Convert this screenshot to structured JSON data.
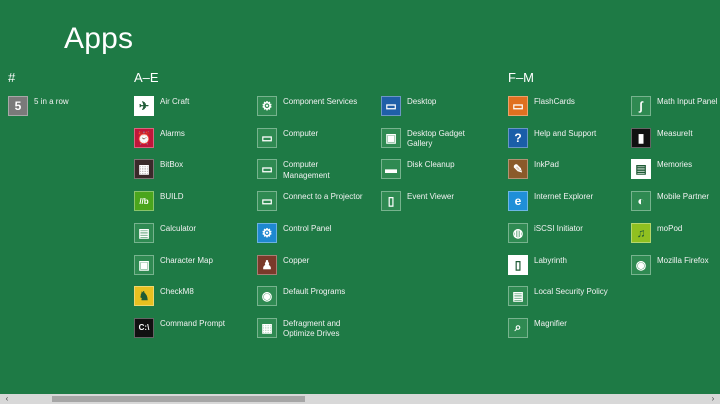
{
  "title": "Apps",
  "groups": {
    "hash": "#",
    "a_e": "A–E",
    "f_m": "F–M"
  },
  "apps": [
    {
      "label": "5 in a row",
      "icon": "five-icon",
      "glyph": "5",
      "color": "#7a7a7a"
    },
    {
      "label": "Air Craft",
      "icon": "paper-plane-icon",
      "glyph": "✈",
      "color": "#ffffff"
    },
    {
      "label": "Alarms",
      "icon": "alarm-clock-icon",
      "glyph": "⏰",
      "color": "#c0163a"
    },
    {
      "label": "BitBox",
      "icon": "bitbox-icon",
      "glyph": "▦",
      "color": "#3a2a2a"
    },
    {
      "label": "BUILD",
      "icon": "build-icon",
      "glyph": "//b",
      "color": "#4aa51d"
    },
    {
      "label": "Calculator",
      "icon": "calculator-icon",
      "glyph": "▤",
      "color": "#2f8a52"
    },
    {
      "label": "Character Map",
      "icon": "character-map-icon",
      "glyph": "▣",
      "color": "#2f8a52"
    },
    {
      "label": "CheckM8",
      "icon": "checkm8-icon",
      "glyph": "♞",
      "color": "#e8c020"
    },
    {
      "label": "Command Prompt",
      "icon": "command-prompt-icon",
      "glyph": "C:\\",
      "color": "#111111"
    },
    {
      "label": "Component Services",
      "icon": "component-services-icon",
      "glyph": "⚙",
      "color": "#2f8a52"
    },
    {
      "label": "Computer",
      "icon": "computer-icon",
      "glyph": "▭",
      "color": "#2f8a52"
    },
    {
      "label": "Computer Management",
      "icon": "computer-management-icon",
      "glyph": "▭",
      "color": "#2f8a52"
    },
    {
      "label": "Connect to a Projector",
      "icon": "projector-icon",
      "glyph": "▭",
      "color": "#2f8a52"
    },
    {
      "label": "Control Panel",
      "icon": "control-panel-icon",
      "glyph": "⚙",
      "color": "#1e88d0"
    },
    {
      "label": "Copper",
      "icon": "copper-icon",
      "glyph": "♟",
      "color": "#7a3a2a"
    },
    {
      "label": "Default Programs",
      "icon": "default-programs-icon",
      "glyph": "◉",
      "color": "#2f8a52"
    },
    {
      "label": "Defragment and Optimize Drives",
      "icon": "defragment-icon",
      "glyph": "▦",
      "color": "#2f8a52"
    },
    {
      "label": "Desktop",
      "icon": "desktop-icon",
      "glyph": "▭",
      "color": "#1f5fa8"
    },
    {
      "label": "Desktop Gadget Gallery",
      "icon": "gadget-gallery-icon",
      "glyph": "▣",
      "color": "#2f8a52"
    },
    {
      "label": "Disk Cleanup",
      "icon": "disk-cleanup-icon",
      "glyph": "▬",
      "color": "#2f8a52"
    },
    {
      "label": "Event Viewer",
      "icon": "event-viewer-icon",
      "glyph": "▯",
      "color": "#2f8a52"
    },
    {
      "label": "FlashCards",
      "icon": "flashcards-icon",
      "glyph": "▭",
      "color": "#e07020"
    },
    {
      "label": "Help and Support",
      "icon": "help-icon",
      "glyph": "?",
      "color": "#1a5ea8"
    },
    {
      "label": "InkPad",
      "icon": "inkpad-icon",
      "glyph": "✎",
      "color": "#8a5a2a"
    },
    {
      "label": "Internet Explorer",
      "icon": "internet-explorer-icon",
      "glyph": "e",
      "color": "#1f8fd8"
    },
    {
      "label": "iSCSI Initiator",
      "icon": "iscsi-icon",
      "glyph": "◍",
      "color": "#2f8a52"
    },
    {
      "label": "Labyrinth",
      "icon": "labyrinth-icon",
      "glyph": "▯",
      "color": "#ffffff"
    },
    {
      "label": "Local Security Policy",
      "icon": "security-policy-icon",
      "glyph": "▤",
      "color": "#2f8a52"
    },
    {
      "label": "Magnifier",
      "icon": "magnifier-icon",
      "glyph": "⌕",
      "color": "#2f8a52"
    },
    {
      "label": "Math Input Panel",
      "icon": "math-input-icon",
      "glyph": "∫",
      "color": "#2f8a52"
    },
    {
      "label": "MeasureIt",
      "icon": "measureit-icon",
      "glyph": "▮",
      "color": "#111111"
    },
    {
      "label": "Memories",
      "icon": "memories-icon",
      "glyph": "▤",
      "color": "#ffffff"
    },
    {
      "label": "Mobile Partner",
      "icon": "mobile-partner-icon",
      "glyph": "◐",
      "color": "#2f8a52"
    },
    {
      "label": "moPod",
      "icon": "mopod-icon",
      "glyph": "♫",
      "color": "#90c020"
    },
    {
      "label": "Mozilla Firefox",
      "icon": "firefox-icon",
      "glyph": "◉",
      "color": "#2f8a52"
    }
  ],
  "scrollbar": {
    "left_arrow": "‹",
    "right_arrow": "›"
  }
}
